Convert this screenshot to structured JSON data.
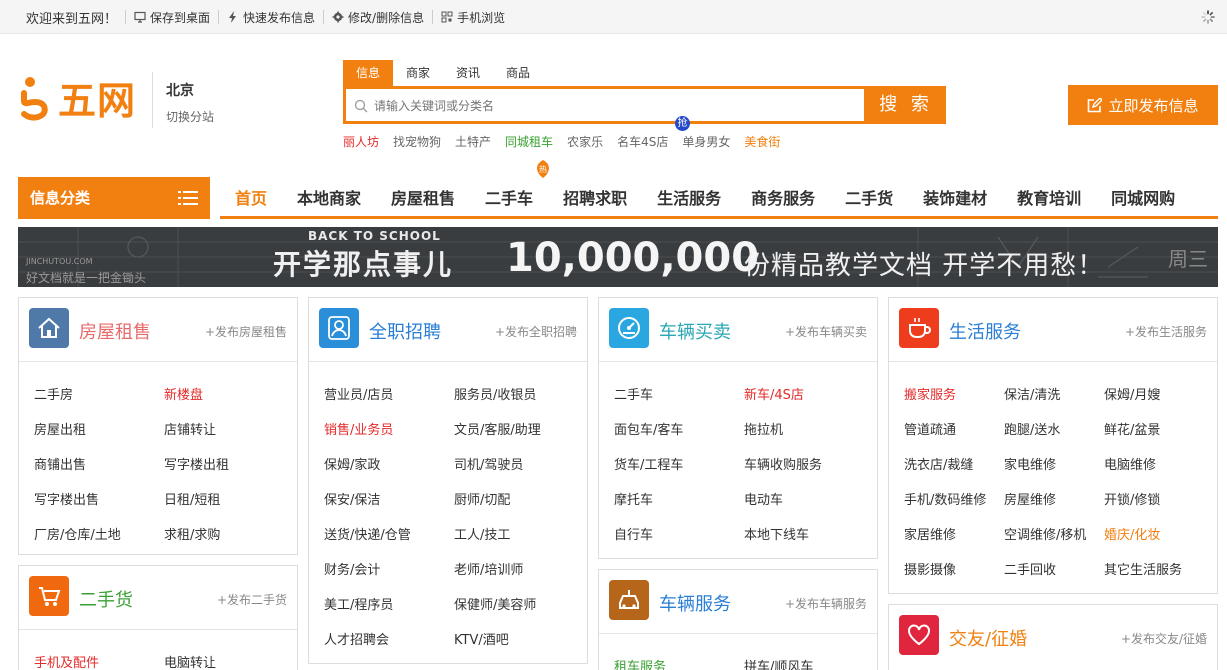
{
  "topbar": {
    "welcome": "欢迎来到五网！",
    "items": [
      "保存到桌面",
      "快速发布信息",
      "修改/删除信息",
      "手机浏览"
    ]
  },
  "logo": {
    "name": "五网",
    "icon": "logo-s-icon",
    "color": "#f18010"
  },
  "city": {
    "name": "北京",
    "switch": "切换分站"
  },
  "search": {
    "tabs": [
      "信息",
      "商家",
      "资讯",
      "商品"
    ],
    "placeholder": "请输入关键词或分类名",
    "button": "搜 索",
    "hot_badge": "抢",
    "hotwords": [
      "丽人坊",
      "找宠物狗",
      "土特产",
      "同城租车",
      "农家乐",
      "名车4S店",
      "单身男女",
      "美食街"
    ]
  },
  "post_button": "立即发布信息",
  "nav": {
    "category_label": "信息分类",
    "hot_badge": "热",
    "items": [
      "首页",
      "本地商家",
      "房屋租售",
      "二手车",
      "招聘求职",
      "生活服务",
      "商务服务",
      "二手货",
      "装饰建材",
      "教育培训",
      "同城网购"
    ]
  },
  "banner": {
    "tag": "BACK TO SCHOOL",
    "headline": "开学那点事儿",
    "number": "10,000,000",
    "tail": "份精品教学文档  开学不用愁！",
    "site": "JINCHUTOU.COM",
    "slogan": "好文档就是一把金锄头",
    "signature": "周三"
  },
  "cards": {
    "house": {
      "title": "房屋租售",
      "publish": "+发布房屋租售",
      "icon": "house-icon",
      "links": [
        "二手房",
        "新楼盘",
        "房屋出租",
        "店铺转让",
        "商铺出售",
        "写字楼出租",
        "写字楼出售",
        "日租/短租",
        "厂房/仓库/土地",
        "求租/求购"
      ]
    },
    "jobs": {
      "title": "全职招聘",
      "publish": "+发布全职招聘",
      "icon": "person-icon",
      "links": [
        "营业员/店员",
        "服务员/收银员",
        "销售/业务员",
        "文员/客服/助理",
        "保姆/家政",
        "司机/驾驶员",
        "保安/保洁",
        "厨师/切配",
        "送货/快递/仓管",
        "工人/技工",
        "财务/会计",
        "老师/培训师",
        "美工/程序员",
        "保健师/美容师",
        "人才招聘会",
        "KTV/酒吧"
      ]
    },
    "cars": {
      "title": "车辆买卖",
      "publish": "+发布车辆买卖",
      "icon": "speedometer-icon",
      "links": [
        "二手车",
        "新车/4S店",
        "面包车/客车",
        "拖拉机",
        "货车/工程车",
        "车辆收购服务",
        "摩托车",
        "电动车",
        "自行车",
        "本地下线车"
      ]
    },
    "life": {
      "title": "生活服务",
      "publish": "+发布生活服务",
      "icon": "coffee-cup-icon",
      "links": [
        "搬家服务",
        "保洁/清洗",
        "保姆/月嫂",
        "管道疏通",
        "跑腿/送水",
        "鲜花/盆景",
        "洗衣店/裁缝",
        "家电维修",
        "电脑维修",
        "手机/数码维修",
        "房屋维修",
        "开锁/修锁",
        "家居维修",
        "空调维修/移机",
        "婚庆/化妆",
        "摄影摄像",
        "二手回收",
        "其它生活服务"
      ]
    },
    "secondhand": {
      "title": "二手货",
      "publish": "+发布二手货",
      "icon": "cart-icon",
      "links": [
        "手机及配件",
        "电脑转让"
      ]
    },
    "carservice": {
      "title": "车辆服务",
      "publish": "+发布车辆服务",
      "icon": "car-tools-icon",
      "links": [
        "租车服务",
        "拼车/顺风车"
      ]
    },
    "dating": {
      "title": "交友/征婚",
      "publish": "+发布交友/征婚",
      "icon": "heart-icon",
      "links": []
    }
  },
  "colors": {
    "accent": "#f18010",
    "red": "#e42a2a",
    "green": "#3aa132",
    "blue": "#2a7fd4"
  }
}
